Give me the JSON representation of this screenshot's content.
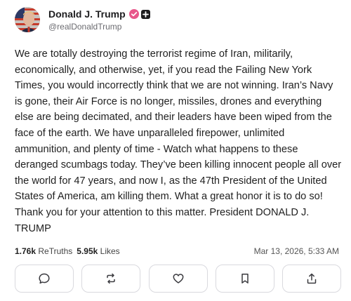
{
  "post": {
    "author": {
      "display_name": "Donald J. Trump",
      "handle": "@realDonaldTrump",
      "avatar_icon": "avatar-image",
      "verified_icon": "verified-badge-icon",
      "badge_icon": "plus-badge-icon"
    },
    "text": "We are totally destroying the terrorist regime of Iran, militarily, economically, and otherwise, yet, if you read the Failing New York Times, you would incorrectly think that we are not winning. Iran’s Navy is gone, their Air Force is no longer, missiles, drones and everything else are being decimated, and their leaders have been wiped from the face of the earth. We have unparalleled firepower, unlimited ammunition, and plenty of time - Watch what happens to these deranged scumbags today. They’ve been killing innocent people all over the world for 47 years, and now I, as the 47th President of the United States of America, am killing them. What a great honor it is to do so! Thank you for your attention to this matter. President DONALD J. TRUMP",
    "stats": {
      "retruths_count": "1.76k",
      "retruths_label": "ReTruths",
      "likes_count": "5.95k",
      "likes_label": "Likes"
    },
    "timestamp": "Mar 13, 2026, 5:33 AM",
    "actions": [
      {
        "name": "reply-button",
        "icon": "reply-icon"
      },
      {
        "name": "retruth-button",
        "icon": "retruth-icon"
      },
      {
        "name": "like-button",
        "icon": "heart-icon"
      },
      {
        "name": "bookmark-button",
        "icon": "bookmark-icon"
      },
      {
        "name": "share-button",
        "icon": "share-icon"
      }
    ],
    "colors": {
      "verified_badge": "#e8568a",
      "text": "#1f1f1f",
      "muted": "#6b6b70",
      "border": "#d9d9de"
    }
  }
}
